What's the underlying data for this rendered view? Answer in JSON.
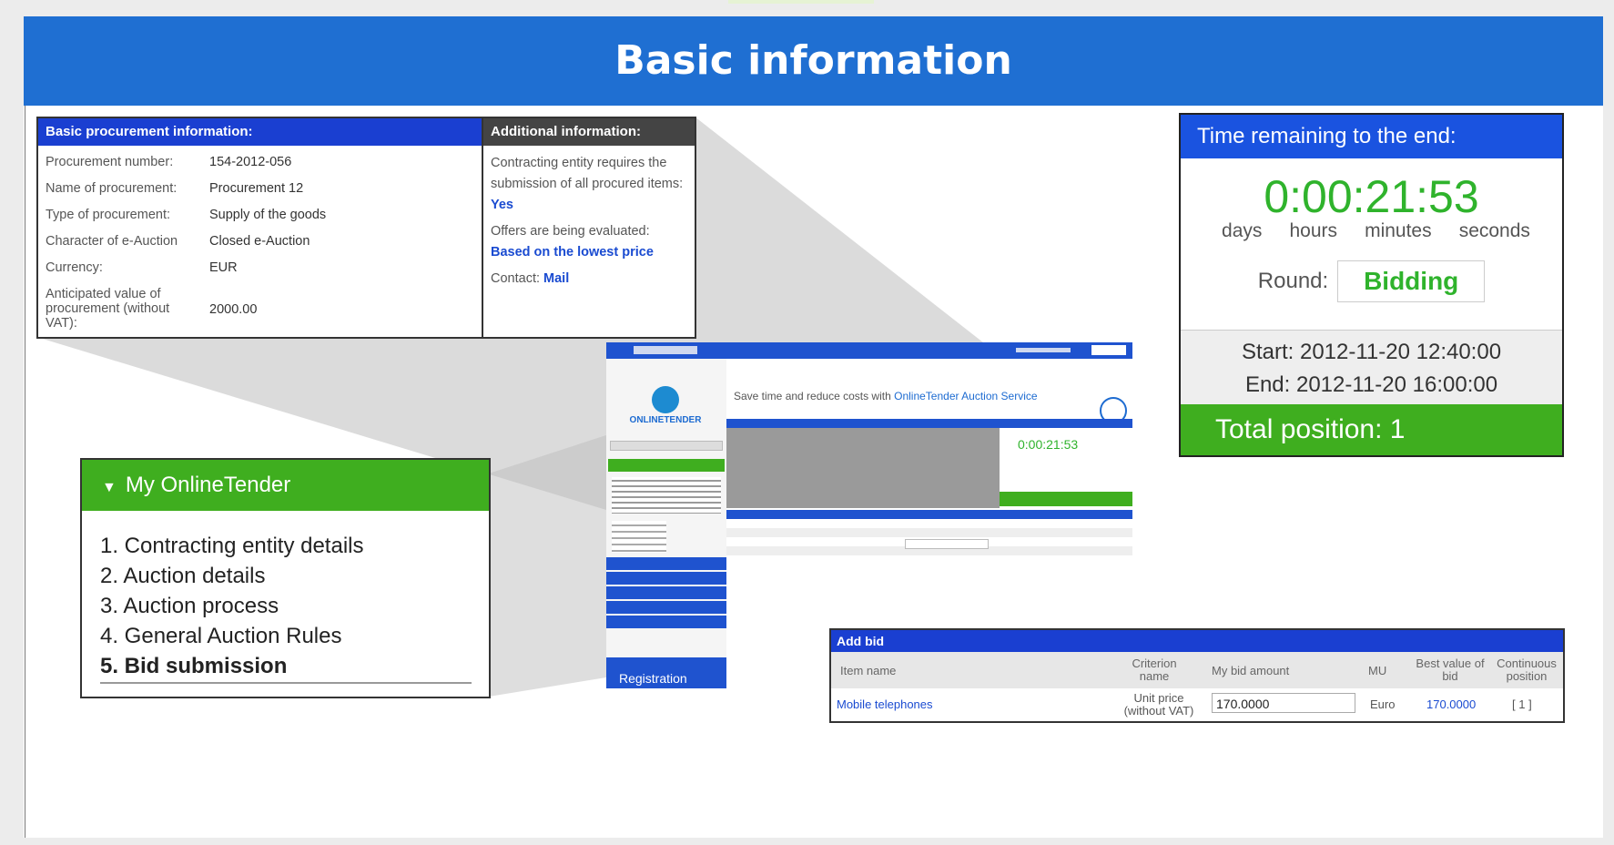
{
  "header": {
    "title": "Basic information"
  },
  "procurement": {
    "title": "Basic procurement information:",
    "rows": [
      {
        "label": "Procurement number:",
        "value": "154-2012-056"
      },
      {
        "label": "Name of procurement:",
        "value": "Procurement 12"
      },
      {
        "label": "Type of procurement:",
        "value": "Supply of the goods"
      },
      {
        "label": "Character of e-Auction",
        "value": "Closed e-Auction"
      },
      {
        "label": "Currency:",
        "value": "EUR"
      },
      {
        "label": "Anticipated value of procurement (without VAT):",
        "value": "2000.00"
      }
    ]
  },
  "additional": {
    "title": "Additional information:",
    "text1": "Contracting entity requires the submission of all procured items:",
    "yes": "Yes",
    "text2": "Offers are being evaluated:",
    "evaluation": "Based on the lowest price",
    "contact_label": "Contact:",
    "contact_link": "Mail"
  },
  "my_onlinetender": {
    "title": "My OnlineTender",
    "items": [
      "1. Contracting entity details",
      "2. Auction details",
      "3. Auction process",
      "4. General Auction Rules",
      "5. Bid submission"
    ]
  },
  "timer": {
    "title": "Time remaining to the end:",
    "digits": "0:00:21:53",
    "units": [
      "days",
      "hours",
      "minutes",
      "seconds"
    ],
    "round_label": "Round:",
    "round_value": "Bidding",
    "start": "Start: 2012-11-20 12:40:00",
    "end": "End: 2012-11-20 16:00:00",
    "total_position": "Total position: 1"
  },
  "mini": {
    "logo": "ONLINETENDER",
    "slogan": "Save time and reduce costs with",
    "slogan_link": "OnlineTender Auction Service",
    "timer_digits": "0:00:21:53",
    "registration": "Registration"
  },
  "add_bid": {
    "title": "Add bid",
    "columns": {
      "item_name": "Item name",
      "criterion": "Criterion name",
      "my_bid": "My bid amount",
      "mu": "MU",
      "best_value": "Best value of bid",
      "continuous": "Continuous position"
    },
    "row": {
      "item_name": "Mobile telephones",
      "criterion": "Unit price (without VAT)",
      "my_bid": "170.0000",
      "mu": "Euro",
      "best_value": "170.0000",
      "position": "[ 1 ]"
    }
  },
  "colors": {
    "header_blue": "#1f6fd2",
    "panel_blue": "#1a3fd1",
    "green": "#3fae1f",
    "timer_green": "#2fb32c"
  }
}
